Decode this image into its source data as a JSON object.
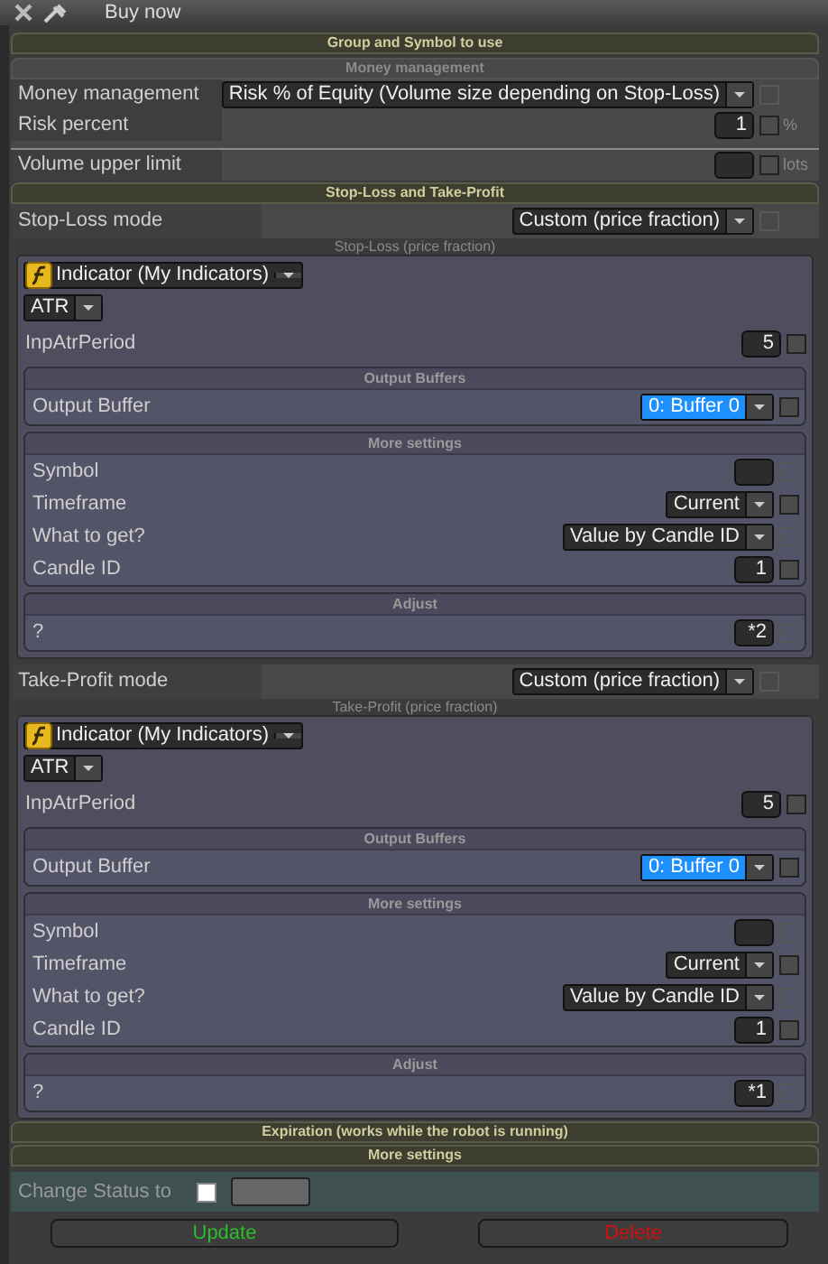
{
  "window": {
    "title": "Buy now"
  },
  "group_header": "Group and Symbol to use",
  "money_management": {
    "title": "Money management",
    "rows": [
      {
        "kind": "select",
        "label": "Money management",
        "value": "Risk % of Equity (Volume size depending on Stop-Loss)",
        "focused": false,
        "checked": false,
        "disabled": true
      },
      {
        "kind": "number",
        "label": "Risk percent",
        "value": "1",
        "checked": false,
        "disabled": false,
        "unit": "%"
      },
      {
        "kind": "number",
        "label": "Volume upper limit",
        "checked": false,
        "disabled": false,
        "unit": "lots"
      }
    ]
  },
  "sl_tp": {
    "title": "Stop-Loss and Take-Profit",
    "blocks": [
      {
        "mode_label": "Stop-Loss mode",
        "mode_value": "Custom (price fraction)",
        "mode_disabled": true,
        "caption": "Stop-Loss (price fraction)",
        "source": "Indicator (My Indicators)",
        "indicator": "ATR",
        "params": [
          {
            "kind": "number",
            "label": "InpAtrPeriod",
            "value": "5",
            "checked": false,
            "disabled": false
          }
        ],
        "subpanels": [
          {
            "title": "Output Buffers",
            "rows": [
              {
                "kind": "select",
                "label": "Output Buffer",
                "value": "0: Buffer 0",
                "focused": true,
                "checked": false,
                "disabled": false
              }
            ]
          },
          {
            "title": "More settings",
            "rows": [
              {
                "kind": "number",
                "label": "Symbol",
                "checked": false,
                "disabled": true
              },
              {
                "kind": "select",
                "label": "Timeframe",
                "value": "Current",
                "focused": false,
                "checked": false,
                "disabled": false
              },
              {
                "kind": "select",
                "label": "What to get?",
                "value": "Value by Candle ID",
                "focused": false,
                "checked": false,
                "disabled": true
              },
              {
                "kind": "number",
                "label": "Candle ID",
                "value": "1",
                "checked": false,
                "disabled": false
              }
            ]
          },
          {
            "title": "Adjust",
            "rows": [
              {
                "kind": "number",
                "label": "?",
                "value": "*2",
                "checked": false,
                "disabled": true
              }
            ]
          }
        ]
      },
      {
        "mode_label": "Take-Profit mode",
        "mode_value": "Custom (price fraction)",
        "mode_disabled": true,
        "caption": "Take-Profit (price fraction)",
        "source": "Indicator (My Indicators)",
        "indicator": "ATR",
        "params": [
          {
            "kind": "number",
            "label": "InpAtrPeriod",
            "value": "5",
            "checked": false,
            "disabled": false
          }
        ],
        "subpanels": [
          {
            "title": "Output Buffers",
            "rows": [
              {
                "kind": "select",
                "label": "Output Buffer",
                "value": "0: Buffer 0",
                "focused": true,
                "checked": false,
                "disabled": false
              }
            ]
          },
          {
            "title": "More settings",
            "rows": [
              {
                "kind": "number",
                "label": "Symbol",
                "checked": false,
                "disabled": true
              },
              {
                "kind": "select",
                "label": "Timeframe",
                "value": "Current",
                "focused": false,
                "checked": false,
                "disabled": false
              },
              {
                "kind": "select",
                "label": "What to get?",
                "value": "Value by Candle ID",
                "focused": false,
                "checked": false,
                "disabled": true
              },
              {
                "kind": "number",
                "label": "Candle ID",
                "value": "1",
                "checked": false,
                "disabled": false
              }
            ]
          },
          {
            "title": "Adjust",
            "rows": [
              {
                "kind": "number",
                "label": "?",
                "value": "*1",
                "checked": false,
                "disabled": true
              }
            ]
          }
        ]
      }
    ]
  },
  "footer_sections": [
    "Expiration (works while the robot is running)",
    "More settings"
  ],
  "status": {
    "label": "Change Status to",
    "checked": false
  },
  "buttons": [
    {
      "label": "Update",
      "kind": "confirm"
    },
    {
      "label": "Delete",
      "kind": "danger"
    }
  ]
}
